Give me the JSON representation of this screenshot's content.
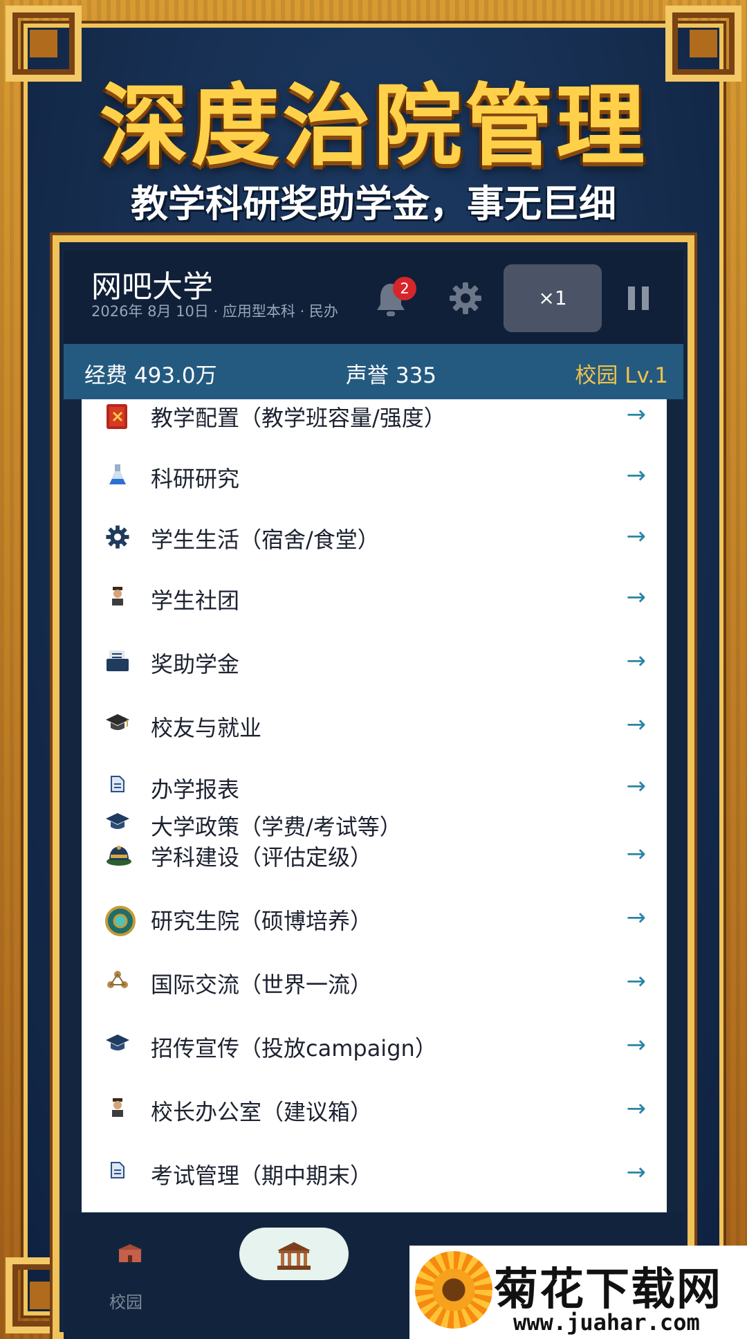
{
  "banner": {
    "title": "深度治院管理",
    "subtitle": "教学科研奖助学金，事无巨细"
  },
  "header": {
    "school_name": "网吧大学",
    "meta": "2026年 8月 10日 · 应用型本科 · 民办",
    "notification_count": "2",
    "speed_label": "×1"
  },
  "stats": {
    "funds": "经费 493.0万",
    "reputation": "声誉 335",
    "campus_level": "校园 Lv.1"
  },
  "menu": {
    "items": [
      {
        "label": "教学配置（教学班容量/强度）",
        "icon": "red-book-icon"
      },
      {
        "label": "科研研究",
        "icon": "flask-icon"
      },
      {
        "label": "学生生活（宿舍/食堂）",
        "icon": "gear-icon"
      },
      {
        "label": "学生社团",
        "icon": "person-icon"
      },
      {
        "label": "奖助学金",
        "icon": "document-tray-icon"
      },
      {
        "label": "校友与就业",
        "icon": "graduation-cap-icon"
      },
      {
        "label": "办学报表",
        "icon": "report-icon"
      },
      {
        "label": "大学政策（学费/考试等）",
        "icon": "graduation-cap-icon"
      },
      {
        "label": "学科建设（评估定级）",
        "icon": "ornate-hat-icon"
      },
      {
        "label": "研究生院（硕博培养）",
        "icon": "medallion-icon"
      },
      {
        "label": "国际交流（世界一流）",
        "icon": "network-icon"
      },
      {
        "label": "招传宣传（投放campaign）",
        "icon": "graduation-cap-icon"
      },
      {
        "label": "校长办公室（建议箱）",
        "icon": "person-icon"
      },
      {
        "label": "考试管理（期中期末）",
        "icon": "report-icon"
      }
    ],
    "arrow": "→"
  },
  "bottom_nav": {
    "campus_label": "校园"
  },
  "watermark": {
    "title": "菊花下载网",
    "url": "www.juahar.com"
  },
  "colors": {
    "accent_gold": "#ffd14a",
    "stats_bar": "#245a80",
    "arrow": "#2b84a6",
    "badge": "#d7262b"
  }
}
